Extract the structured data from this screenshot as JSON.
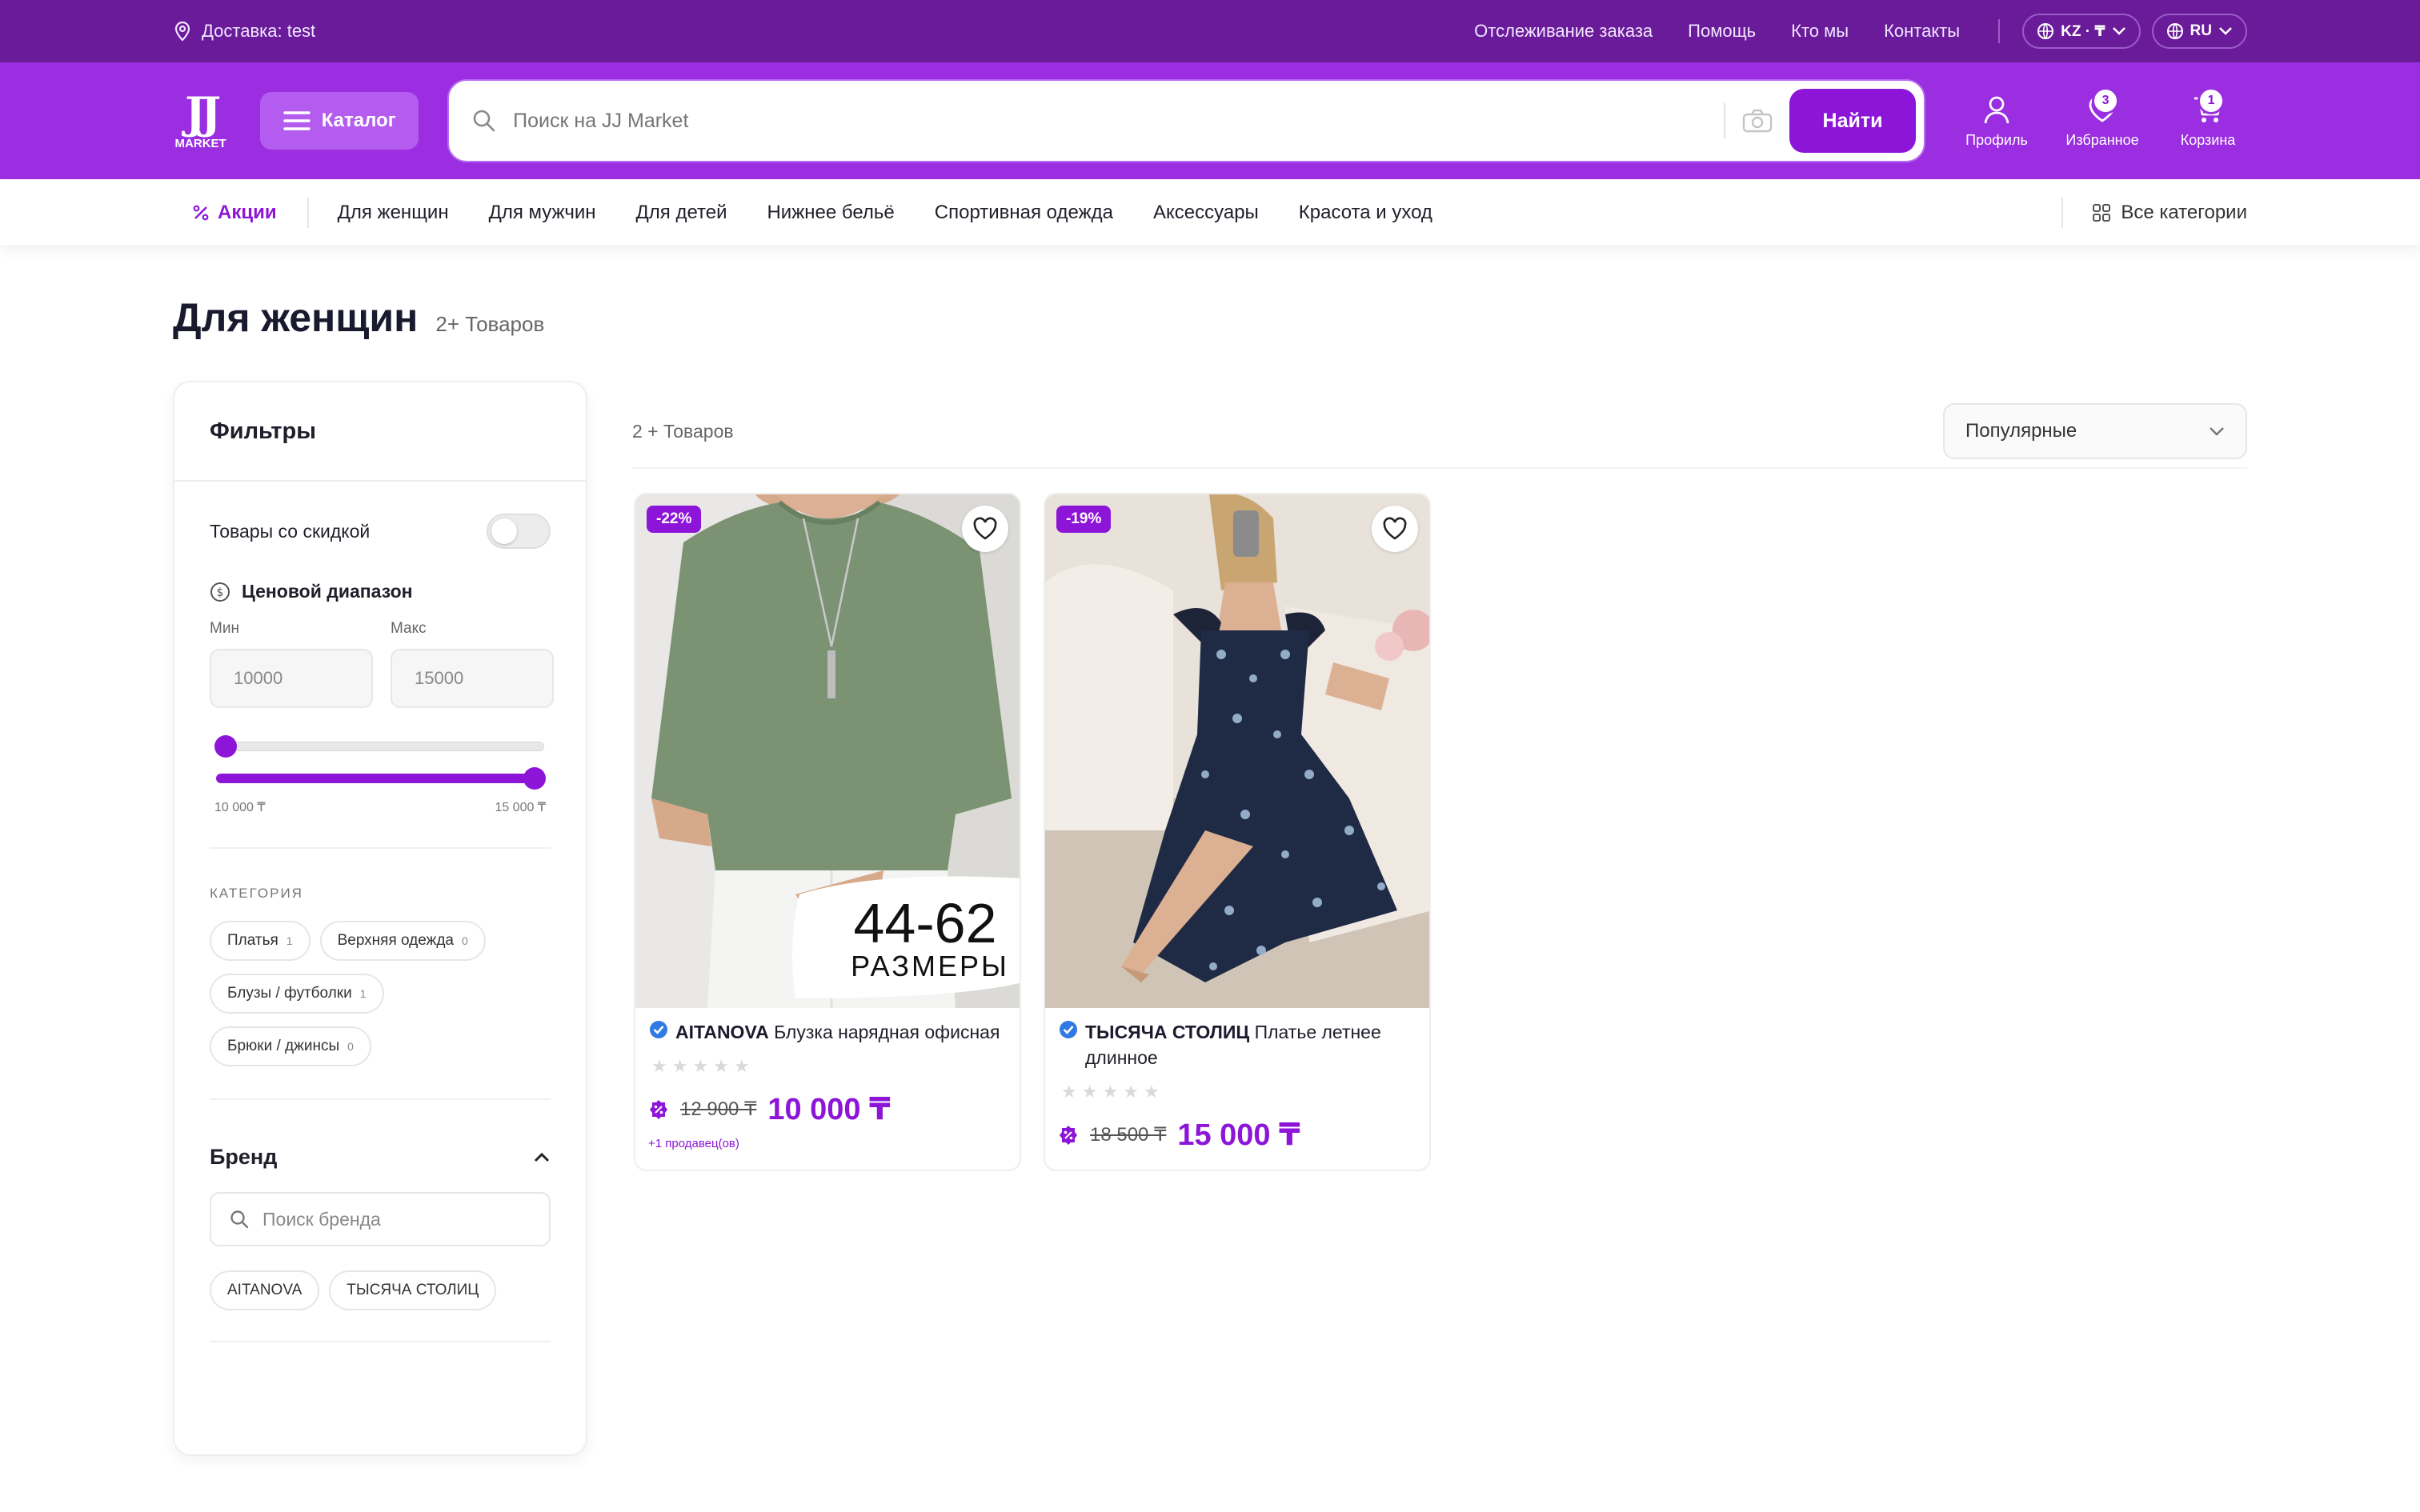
{
  "topbar": {
    "delivery": "Доставка: test",
    "links": [
      "Отслеживание заказа",
      "Помощь",
      "Кто мы",
      "Контакты"
    ],
    "region": "KZ · ₸",
    "language": "RU"
  },
  "header": {
    "logo_jj": "JJ",
    "logo_market": "MARKET",
    "catalog": "Каталог",
    "search_placeholder": "Поиск на JJ Market",
    "search_button": "Найти",
    "profile": "Профиль",
    "favorites": "Избранное",
    "favorites_count": "3",
    "cart": "Корзина",
    "cart_count": "1"
  },
  "nav": {
    "promo": "Акции",
    "items": [
      "Для женщин",
      "Для мужчин",
      "Для детей",
      "Нижнее бельё",
      "Спортивная одежда",
      "Аксессуары",
      "Красота и уход"
    ],
    "all_categories": "Все категории"
  },
  "page": {
    "title": "Для женщин",
    "count": "2+ Товаров"
  },
  "filters": {
    "title": "Фильтры",
    "discount_toggle": "Товары со скидкой",
    "price_range": "Ценовой диапазон",
    "min_label": "Мин",
    "max_label": "Макс",
    "min_value": "10000",
    "max_value": "15000",
    "slider_min": "10 000 ₸",
    "slider_max": "15 000 ₸",
    "category_header": "КАТЕГОРИЯ",
    "categories": [
      {
        "name": "Платья",
        "count": "1"
      },
      {
        "name": "Верхняя одежда",
        "count": "0"
      },
      {
        "name": "Блузы / футболки",
        "count": "1"
      },
      {
        "name": "Брюки / джинсы",
        "count": "0"
      }
    ],
    "brand_header": "Бренд",
    "brand_search_placeholder": "Поиск бренда",
    "brands": [
      "AITANOVA",
      "ТЫСЯЧА СТОЛИЦ"
    ]
  },
  "results": {
    "count": "2 + Товаров",
    "sort": "Популярные"
  },
  "products": [
    {
      "discount": "-22%",
      "brand": "AITANOVA",
      "name": "Блузка нарядная офисная",
      "old_price": "12 900 ₸",
      "price": "10 000 ₸",
      "sellers": "+1 продавец(ов)",
      "overlay_big": "44-62",
      "overlay_small": "РАЗМЕРЫ"
    },
    {
      "discount": "-19%",
      "brand": "ТЫСЯЧА СТОЛИЦ",
      "name": "Платье летнее длинное",
      "old_price": "18 500 ₸",
      "price": "15 000 ₸"
    }
  ],
  "colors": {
    "topbar": "#6a1b9a",
    "header": "#9a2ee0",
    "accent": "#8d15d8"
  }
}
